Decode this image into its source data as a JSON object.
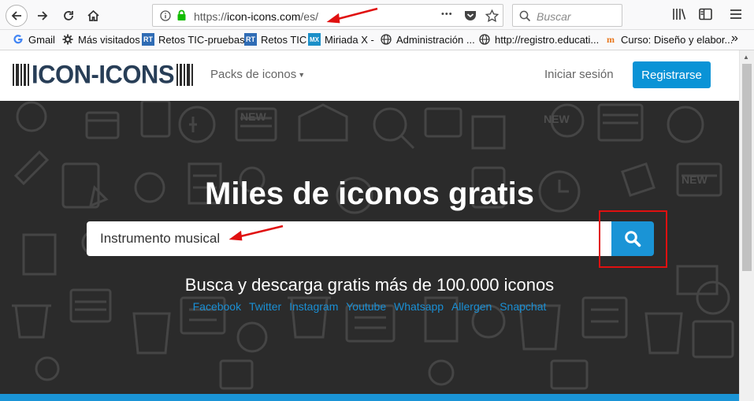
{
  "browser": {
    "url_prefix": "https://",
    "url_host": "icon-icons.com",
    "url_path": "/es/",
    "search_placeholder": "Buscar",
    "more_label": "•••"
  },
  "bookmarks": [
    {
      "label": "Gmail"
    },
    {
      "label": "Más visitados"
    },
    {
      "label": "Retos TIC-pruebas"
    },
    {
      "label": "Retos TIC"
    },
    {
      "label": "Miriada X -"
    },
    {
      "label": "Administración ..."
    },
    {
      "label": "http://registro.educati..."
    },
    {
      "label": "Curso: Diseño y elabor..."
    }
  ],
  "site": {
    "logo_text": "ICON-ICONS",
    "packs_label": "Packs de iconos",
    "login_label": "Iniciar sesión",
    "register_label": "Registrarse"
  },
  "hero": {
    "title": "Miles de iconos gratis",
    "search_value": "Instrumento musical",
    "subtitle": "Busca y descarga gratis más de 100.000 iconos",
    "social_links": [
      "Facebook",
      "Twitter",
      "Instagram",
      "Youtube",
      "Whatsapp",
      "Allergen",
      "Snapchat"
    ]
  },
  "colors": {
    "accent": "#1a94d6",
    "hero_bg": "#2b2b2b",
    "annotation": "#e01010"
  }
}
